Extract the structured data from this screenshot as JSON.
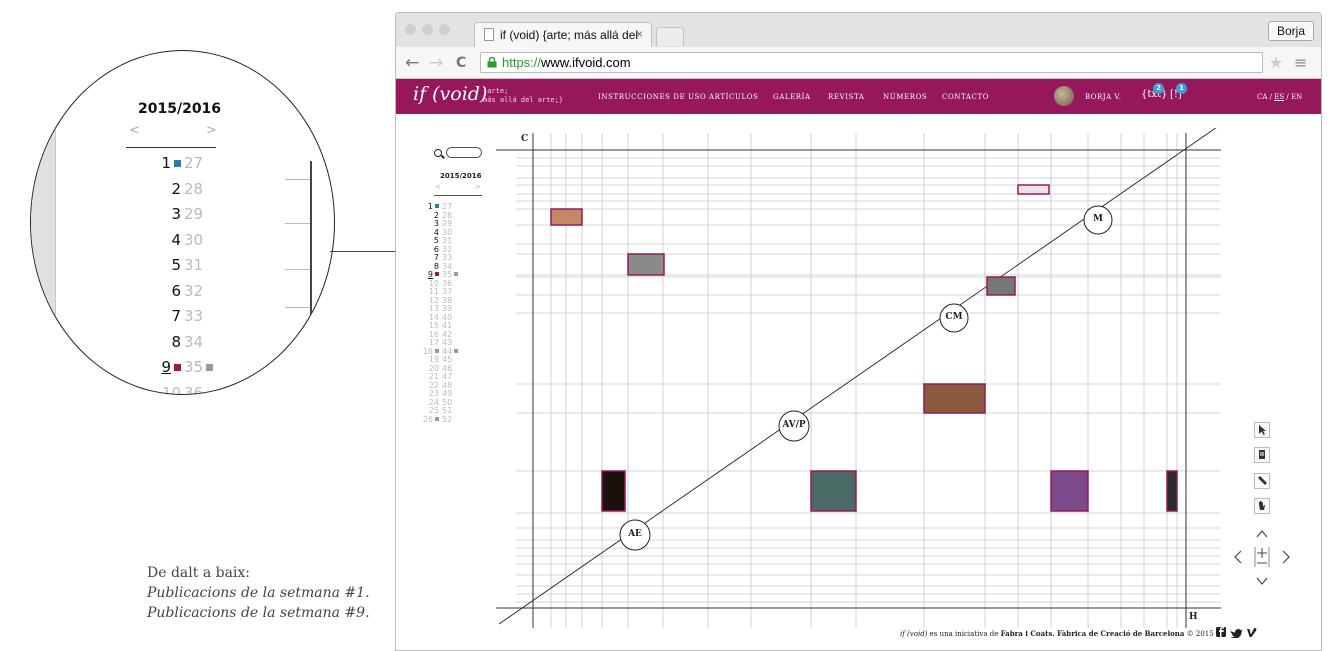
{
  "magnifier": {
    "year": "2015/2016",
    "prev": "<",
    "next": ">",
    "rows": [
      {
        "a": "1",
        "b": "27",
        "mark": "teal"
      },
      {
        "a": "2",
        "b": "28"
      },
      {
        "a": "3",
        "b": "29"
      },
      {
        "a": "4",
        "b": "30"
      },
      {
        "a": "5",
        "b": "31"
      },
      {
        "a": "6",
        "b": "32"
      },
      {
        "a": "7",
        "b": "33"
      },
      {
        "a": "8",
        "b": "34"
      },
      {
        "a": "9",
        "b": "35",
        "mark": "magenta",
        "markB": "gray"
      },
      {
        "a": "10",
        "b": "36",
        "faded": true
      }
    ]
  },
  "caption": {
    "line1": "De dalt a baix:",
    "line2": "Publicacions de la setmana #1.",
    "line3": "Publicacions de la setmana #9."
  },
  "browser": {
    "tab_title": "if (void) {arte; más allá del",
    "tab_close": "×",
    "profile": "Borja",
    "url_scheme": "https://",
    "url_host": "www.ifvoid.com",
    "back": "←",
    "forward": "→",
    "reload": "C",
    "star": "★",
    "menu": "≡"
  },
  "site": {
    "logo": "if (void)",
    "tagline": "{arte;\nmás allá del arte;}",
    "nav": [
      "INSTRUCCIONES DE USO",
      "ARTÍCULOS",
      "GALERÍA",
      "REVISTA",
      "NÚMEROS",
      "CONTACTO"
    ],
    "user_name": "BORJA V.",
    "txt_label": "{txt}",
    "txt_count": "2",
    "alert_label": "[!]",
    "alert_count": "1",
    "lang_ca": "CA",
    "lang_es": "ES",
    "lang_en": "EN",
    "lang_sep": "/"
  },
  "sidebar": {
    "year": "2015/2016",
    "prev": "<",
    "next": ">",
    "rows": [
      {
        "a": "1",
        "b": "27",
        "mark": "teal"
      },
      {
        "a": "2",
        "b": "28"
      },
      {
        "a": "3",
        "b": "29"
      },
      {
        "a": "4",
        "b": "30"
      },
      {
        "a": "5",
        "b": "31"
      },
      {
        "a": "6",
        "b": "32"
      },
      {
        "a": "7",
        "b": "33"
      },
      {
        "a": "8",
        "b": "34"
      },
      {
        "a": "9",
        "b": "35",
        "mark": "magenta",
        "markB": "gray"
      },
      {
        "a": "10",
        "b": "36",
        "faded": true
      },
      {
        "a": "11",
        "b": "37",
        "faded": true
      },
      {
        "a": "12",
        "b": "38",
        "faded": true
      },
      {
        "a": "13",
        "b": "39",
        "faded": true
      },
      {
        "a": "14",
        "b": "40",
        "faded": true
      },
      {
        "a": "15",
        "b": "41",
        "faded": true
      },
      {
        "a": "16",
        "b": "42",
        "faded": true
      },
      {
        "a": "17",
        "b": "43",
        "faded": true
      },
      {
        "a": "18",
        "b": "44",
        "faded": true,
        "mark": "gray",
        "markB": "gray"
      },
      {
        "a": "19",
        "b": "45",
        "faded": true
      },
      {
        "a": "20",
        "b": "46",
        "faded": true
      },
      {
        "a": "21",
        "b": "47",
        "faded": true
      },
      {
        "a": "22",
        "b": "48",
        "faded": true
      },
      {
        "a": "23",
        "b": "49",
        "faded": true
      },
      {
        "a": "24",
        "b": "50",
        "faded": true
      },
      {
        "a": "25",
        "b": "51",
        "faded": true
      },
      {
        "a": "26",
        "b": "52",
        "faded": true,
        "mark": "gray"
      }
    ]
  },
  "grid": {
    "axis_c": "C",
    "axis_h": "H",
    "nodes": [
      "M",
      "CM",
      "AV/P",
      "AE"
    ]
  },
  "tools": {
    "pointer": "pointer-icon",
    "document": "document-icon",
    "pencil": "pencil-icon",
    "hand": "hand-icon",
    "up": "^",
    "left": "<",
    "zoom": "+",
    "right": ">",
    "down": "v"
  },
  "footer": {
    "pre": "if (void)",
    "mid": " es una iniciativa de ",
    "org": "Fabra i Coats. Fàbrica de Creació de Barcelona",
    "year": " © 2015",
    "social": "f ♥ V"
  },
  "colors": {
    "brand": "#96185a",
    "teal": "#2a7f9e",
    "magenta": "#96185a",
    "gray": "#999999"
  }
}
